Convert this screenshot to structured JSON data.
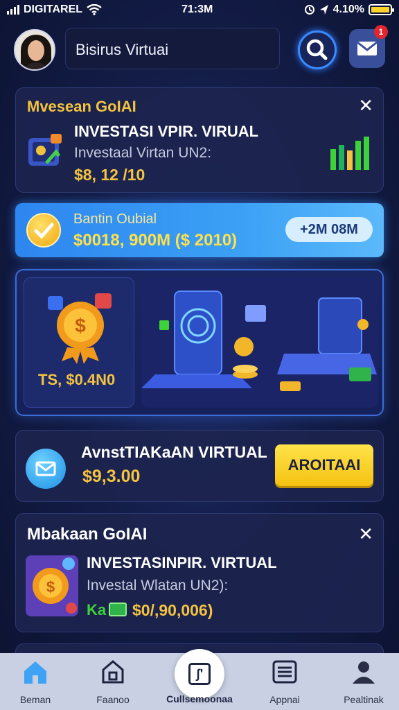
{
  "status_bar": {
    "carrier": "DIGITAREL",
    "time": "71:3M",
    "battery": "4.10%"
  },
  "header": {
    "title": "Bisirus Virtuai",
    "mail_badge": "1"
  },
  "promo_card": {
    "title": "Mvesean GoIAI",
    "investment_title": "INVESTASI VPIR. VIRUAL",
    "investment_subtitle": "Investaal Virtan UN2:",
    "amount": "$8, 12 /10"
  },
  "banner": {
    "label": "Bantin Oubial",
    "value": "$0018, 900M  ($ 2010)",
    "pill": "+2M 08M"
  },
  "hero": {
    "amount": "TS, $0.4N0"
  },
  "withdraw_card": {
    "title": "AvnstTIAKaAN VIRTUAL",
    "amount": "$9,3.00",
    "button": "AROITAAI"
  },
  "second_card": {
    "title": "Mbakaan GoIAI",
    "investment_title": "INVESTASINPIR. VIRTUAL",
    "investment_subtitle": "Investal Wlatan UN2):",
    "prefix": "Ka",
    "amount": "$0/,90,006)"
  },
  "nav": {
    "items": [
      {
        "label": "Beman",
        "icon": "home-icon"
      },
      {
        "label": "Faanoo",
        "icon": "store-icon"
      },
      {
        "label": "Cullsemoonaa",
        "icon": "wallet-icon"
      },
      {
        "label": "Appnai",
        "icon": "menu-icon"
      },
      {
        "label": "Pealtinak",
        "icon": "profile-icon"
      }
    ]
  },
  "colors": {
    "accent_gold": "#f4c340",
    "accent_blue": "#3a8bff",
    "green": "#3dd13a"
  }
}
